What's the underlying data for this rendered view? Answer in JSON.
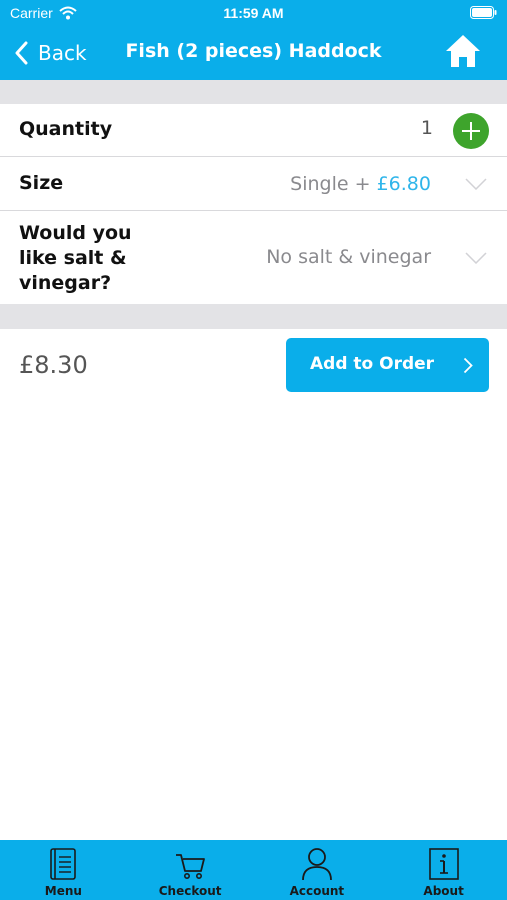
{
  "status_bar": {
    "carrier": "Carrier",
    "time": "11:59 AM",
    "wifi_icon": "wifi-icon",
    "battery_icon": "battery-icon"
  },
  "nav": {
    "back_label": "Back",
    "title": "Fish (2 pieces) Haddock",
    "home_icon": "home-icon"
  },
  "options": {
    "quantity": {
      "label": "Quantity",
      "value": "1",
      "add_icon": "plus-icon"
    },
    "size": {
      "label": "Size",
      "value": "Single + ",
      "price": "£6.80"
    },
    "salt": {
      "label_line1": "Would you",
      "label_line2": "like salt &",
      "label_line3": "vinegar?",
      "value": "No salt & vinegar"
    }
  },
  "order": {
    "total": "£8.30",
    "add_label": "Add to Order"
  },
  "tabs": [
    {
      "label": "Menu",
      "icon": "menu-book-icon"
    },
    {
      "label": "Checkout",
      "icon": "cart-icon"
    },
    {
      "label": "Account",
      "icon": "person-icon"
    },
    {
      "label": "About",
      "icon": "info-icon"
    }
  ],
  "colors": {
    "accent": "#0aaeea",
    "add_green": "#3ea42c",
    "price_blue": "#2fb5ea",
    "separator": "#e3e3e6"
  }
}
